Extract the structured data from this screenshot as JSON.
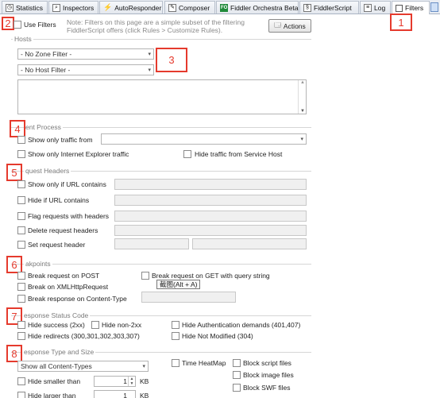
{
  "tabs": [
    {
      "label": "Statistics",
      "icon": "statistics-icon"
    },
    {
      "label": "Inspectors",
      "icon": "inspectors-icon"
    },
    {
      "label": "AutoResponder",
      "icon": "lightning-icon"
    },
    {
      "label": "Composer",
      "icon": "composer-icon"
    },
    {
      "label": "Fiddler Orchestra Beta",
      "icon": "fo-icon",
      "badge": "FO"
    },
    {
      "label": "FiddlerScript",
      "icon": "script-icon"
    },
    {
      "label": "Log",
      "icon": "log-icon"
    },
    {
      "label": "Filters",
      "icon": "checkbox-icon"
    }
  ],
  "annotations": [
    "1",
    "2",
    "3",
    "4",
    "5",
    "6",
    "7",
    "8"
  ],
  "top": {
    "use_filters": "Use Filters",
    "note": "Note: Filters on this page are a simple subset of the filtering FiddlerScript offers (click Rules > Customize Rules).",
    "actions": "Actions"
  },
  "hosts": {
    "title": "Hosts",
    "zone_filter": "- No Zone Filter -",
    "host_filter": "- No Host Filter -"
  },
  "client_process": {
    "title": "ent Process",
    "show_only_from": "Show only traffic from",
    "show_ie": "Show only Internet Explorer traffic",
    "hide_service_host": "Hide traffic from Service Host"
  },
  "request_headers": {
    "title": "quest Headers",
    "items": [
      "Show only if URL contains",
      "Hide if URL contains",
      "Flag requests with headers",
      "Delete request headers",
      "Set request header"
    ]
  },
  "breakpoints": {
    "title": "akpoints",
    "post": "Break request on POST",
    "get": "Break request on GET with query string",
    "xml": "Break on XMLHttpRequest",
    "content_type": "Break response on Content-Type",
    "tooltip": "截图(Alt + A)"
  },
  "status_code": {
    "title": "esponse Status Code",
    "hide_success": "Hide success (2xx)",
    "hide_non2xx": "Hide non-2xx",
    "hide_auth": "Hide Authentication demands (401,407)",
    "hide_redirects": "Hide redirects (300,301,302,303,307)",
    "hide_not_modified": "Hide Not Modified (304)"
  },
  "type_size": {
    "title": "esponse Type and Size",
    "content_types": "Show all Content-Types",
    "time_heatmap": "Time HeatMap",
    "block_script": "Block script files",
    "block_image": "Block image files",
    "block_swf": "Block SWF files",
    "hide_smaller": "Hide smaller than",
    "smaller_value": "1",
    "kb": "KB",
    "hide_larger_partial": "Hide larger than",
    "larger_value": "1",
    "kb2": "KB"
  }
}
